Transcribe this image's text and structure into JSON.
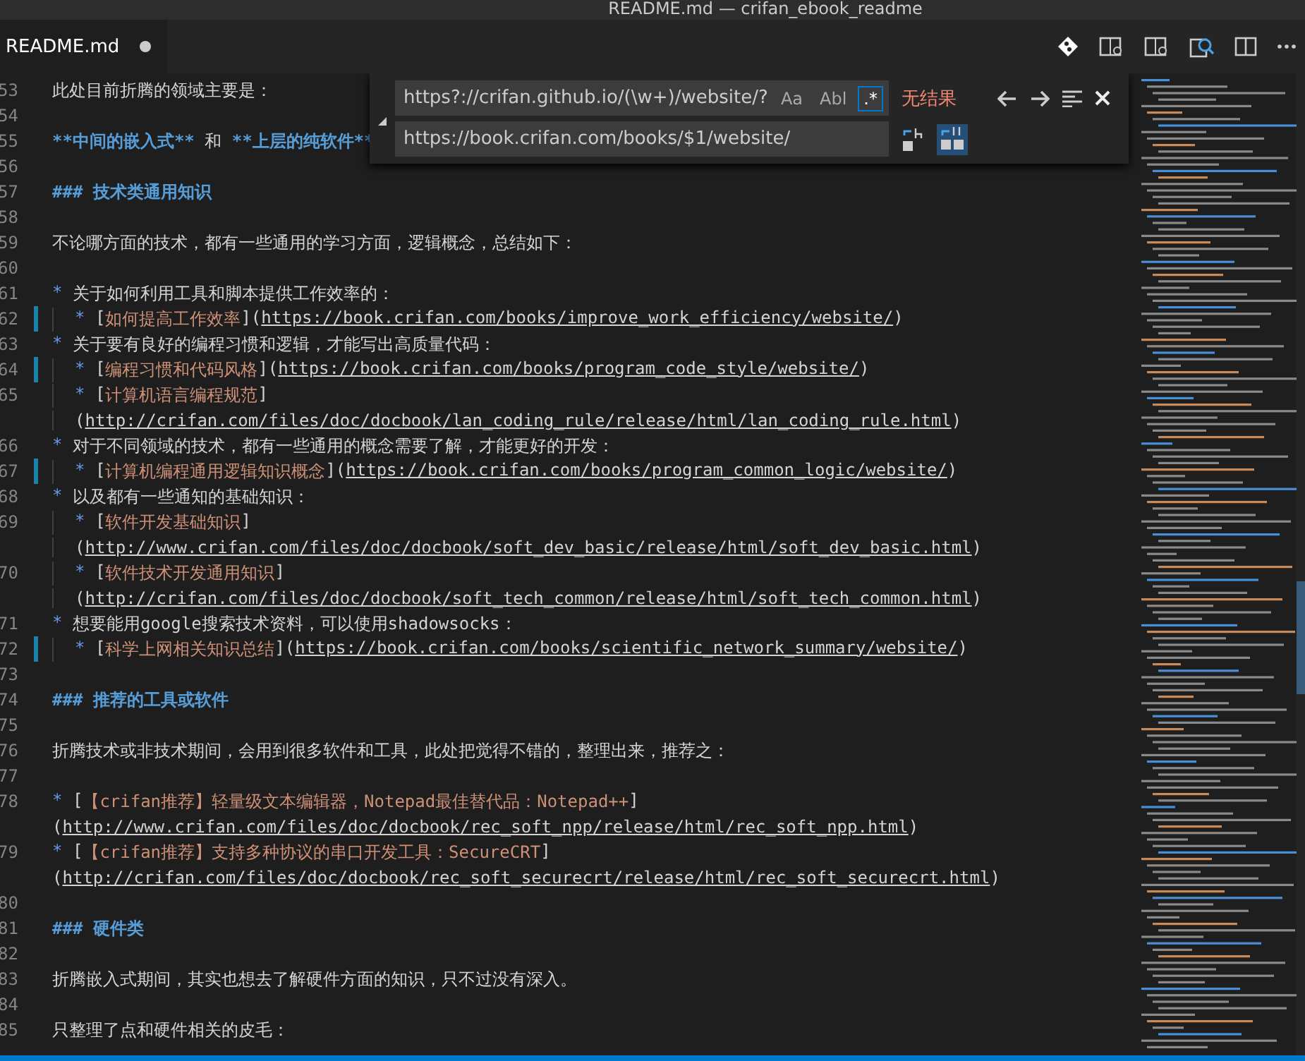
{
  "window": {
    "title": "README.md — crifan_ebook_readme"
  },
  "tabs": [
    {
      "label": "README.md",
      "selected": true,
      "dirty": true
    }
  ],
  "find_widget": {
    "find_value": "https?://crifan.github.io/(\\w+)/website/?",
    "replace_value": "https://book.crifan.com/books/$1/website/",
    "toggles": [
      {
        "label": "Aa",
        "selected": false
      },
      {
        "label": "Abl",
        "selected": false
      },
      {
        "label": ".*",
        "selected": true
      }
    ],
    "result": "无结果",
    "preserve_case": {
      "selected": true
    }
  },
  "lines": [
    {
      "num": "53",
      "parts": [
        {
          "kind": "text",
          "text": "此处目前折腾的领域主要是："
        }
      ]
    },
    {
      "num": "54"
    },
    {
      "num": "55",
      "parts": [
        {
          "kind": "bold",
          "text": "**中间的嵌入式**"
        },
        {
          "kind": "text",
          "text": " 和 "
        },
        {
          "kind": "bold",
          "text": "**上层的纯软件**"
        }
      ]
    },
    {
      "num": "56"
    },
    {
      "num": "57",
      "parts": [
        {
          "kind": "heading",
          "text": "### 技术类通用知识"
        }
      ]
    },
    {
      "num": "58"
    },
    {
      "num": "59",
      "parts": [
        {
          "kind": "text",
          "text": "不论哪方面的技术，都有一些通用的学习方面，逻辑概念，总结如下："
        }
      ]
    },
    {
      "num": "60"
    },
    {
      "num": "61",
      "parts": [
        {
          "kind": "bullet",
          "text": "*"
        },
        {
          "kind": "text",
          "text": " 关于如何利用工具和脚本提供工作效率的："
        }
      ]
    },
    {
      "num": "62",
      "indented": true,
      "modified": true,
      "parts": [
        {
          "kind": "bullet",
          "text": "*"
        },
        {
          "kind": "text",
          "text": " ["
        },
        {
          "kind": "label",
          "text": "如何提高工作效率"
        },
        {
          "kind": "text",
          "text": "]("
        },
        {
          "kind": "url",
          "text": "https://book.crifan.com/books/improve_work_efficiency/website/"
        },
        {
          "kind": "text",
          "text": ")"
        }
      ]
    },
    {
      "num": "63",
      "parts": [
        {
          "kind": "bullet",
          "text": "*"
        },
        {
          "kind": "text",
          "text": " 关于要有良好的编程习惯和逻辑，才能写出高质量代码："
        }
      ]
    },
    {
      "num": "64",
      "indented": true,
      "modified": true,
      "parts": [
        {
          "kind": "bullet",
          "text": "*"
        },
        {
          "kind": "text",
          "text": " ["
        },
        {
          "kind": "label",
          "text": "编程习惯和代码风格"
        },
        {
          "kind": "text",
          "text": "]("
        },
        {
          "kind": "url",
          "text": "https://book.crifan.com/books/program_code_style/website/"
        },
        {
          "kind": "text",
          "text": ")"
        }
      ]
    },
    {
      "num": "65",
      "indented": true,
      "parts": [
        {
          "kind": "bullet",
          "text": "*"
        },
        {
          "kind": "text",
          "text": " ["
        },
        {
          "kind": "label",
          "text": "计算机语言编程规范"
        },
        {
          "kind": "text",
          "text": "]"
        }
      ]
    },
    {
      "indented": true,
      "parts": [
        {
          "kind": "text",
          "text": "("
        },
        {
          "kind": "url",
          "text": "http://crifan.com/files/doc/docbook/lan_coding_rule/release/html/lan_coding_rule.html"
        },
        {
          "kind": "text",
          "text": ")"
        }
      ]
    },
    {
      "num": "66",
      "parts": [
        {
          "kind": "bullet",
          "text": "*"
        },
        {
          "kind": "text",
          "text": " 对于不同领域的技术，都有一些通用的概念需要了解，才能更好的开发："
        }
      ]
    },
    {
      "num": "67",
      "indented": true,
      "modified": true,
      "parts": [
        {
          "kind": "bullet",
          "text": "*"
        },
        {
          "kind": "text",
          "text": " ["
        },
        {
          "kind": "label",
          "text": "计算机编程通用逻辑知识概念"
        },
        {
          "kind": "text",
          "text": "]("
        },
        {
          "kind": "url",
          "text": "https://book.crifan.com/books/program_common_logic/website/"
        },
        {
          "kind": "text",
          "text": ")"
        }
      ]
    },
    {
      "num": "68",
      "parts": [
        {
          "kind": "bullet",
          "text": "*"
        },
        {
          "kind": "text",
          "text": " 以及都有一些通知的基础知识："
        }
      ]
    },
    {
      "num": "69",
      "indented": true,
      "parts": [
        {
          "kind": "bullet",
          "text": "*"
        },
        {
          "kind": "text",
          "text": " ["
        },
        {
          "kind": "label",
          "text": "软件开发基础知识"
        },
        {
          "kind": "text",
          "text": "]"
        }
      ]
    },
    {
      "indented": true,
      "parts": [
        {
          "kind": "text",
          "text": "("
        },
        {
          "kind": "url",
          "text": "http://www.crifan.com/files/doc/docbook/soft_dev_basic/release/html/soft_dev_basic.html"
        },
        {
          "kind": "text",
          "text": ")"
        }
      ]
    },
    {
      "num": "70",
      "indented": true,
      "parts": [
        {
          "kind": "bullet",
          "text": "*"
        },
        {
          "kind": "text",
          "text": " ["
        },
        {
          "kind": "label",
          "text": "软件技术开发通用知识"
        },
        {
          "kind": "text",
          "text": "]"
        }
      ]
    },
    {
      "indented": true,
      "parts": [
        {
          "kind": "text",
          "text": "("
        },
        {
          "kind": "url",
          "text": "http://crifan.com/files/doc/docbook/soft_tech_common/release/html/soft_tech_common.html"
        },
        {
          "kind": "text",
          "text": ")"
        }
      ]
    },
    {
      "num": "71",
      "parts": [
        {
          "kind": "bullet",
          "text": "*"
        },
        {
          "kind": "text",
          "text": " 想要能用google搜索技术资料，可以使用shadowsocks："
        }
      ]
    },
    {
      "num": "72",
      "indented": true,
      "modified": true,
      "parts": [
        {
          "kind": "bullet",
          "text": "*"
        },
        {
          "kind": "text",
          "text": " ["
        },
        {
          "kind": "label",
          "text": "科学上网相关知识总结"
        },
        {
          "kind": "text",
          "text": "]("
        },
        {
          "kind": "url",
          "text": "https://book.crifan.com/books/scientific_network_summary/website/"
        },
        {
          "kind": "text",
          "text": ")"
        }
      ]
    },
    {
      "num": "73"
    },
    {
      "num": "74",
      "parts": [
        {
          "kind": "heading",
          "text": "### 推荐的工具或软件"
        }
      ]
    },
    {
      "num": "75"
    },
    {
      "num": "76",
      "parts": [
        {
          "kind": "text",
          "text": "折腾技术或非技术期间，会用到很多软件和工具，此处把觉得不错的，整理出来，推荐之："
        }
      ]
    },
    {
      "num": "77"
    },
    {
      "num": "78",
      "parts": [
        {
          "kind": "bullet",
          "text": "*"
        },
        {
          "kind": "text",
          "text": " ["
        },
        {
          "kind": "label",
          "text": "【crifan推荐】轻量级文本编辑器，Notepad最佳替代品：Notepad++"
        },
        {
          "kind": "text",
          "text": "]"
        }
      ]
    },
    {
      "parts": [
        {
          "kind": "text",
          "text": "("
        },
        {
          "kind": "url",
          "text": "http://www.crifan.com/files/doc/docbook/rec_soft_npp/release/html/rec_soft_npp.html"
        },
        {
          "kind": "text",
          "text": ")"
        }
      ]
    },
    {
      "num": "79",
      "parts": [
        {
          "kind": "bullet",
          "text": "*"
        },
        {
          "kind": "text",
          "text": " ["
        },
        {
          "kind": "label",
          "text": "【crifan推荐】支持多种协议的串口开发工具：SecureCRT"
        },
        {
          "kind": "text",
          "text": "]"
        }
      ]
    },
    {
      "parts": [
        {
          "kind": "text",
          "text": "("
        },
        {
          "kind": "url",
          "text": "http://crifan.com/files/doc/docbook/rec_soft_securecrt/release/html/rec_soft_securecrt.html"
        },
        {
          "kind": "text",
          "text": ")"
        }
      ]
    },
    {
      "num": "80"
    },
    {
      "num": "81",
      "parts": [
        {
          "kind": "heading",
          "text": "### 硬件类"
        }
      ]
    },
    {
      "num": "82"
    },
    {
      "num": "83",
      "parts": [
        {
          "kind": "text",
          "text": "折腾嵌入式期间，其实也想去了解硬件方面的知识，只不过没有深入。"
        }
      ]
    },
    {
      "num": "84"
    },
    {
      "num": "85",
      "parts": [
        {
          "kind": "text",
          "text": "只整理了点和硬件相关的皮毛："
        }
      ]
    }
  ]
}
